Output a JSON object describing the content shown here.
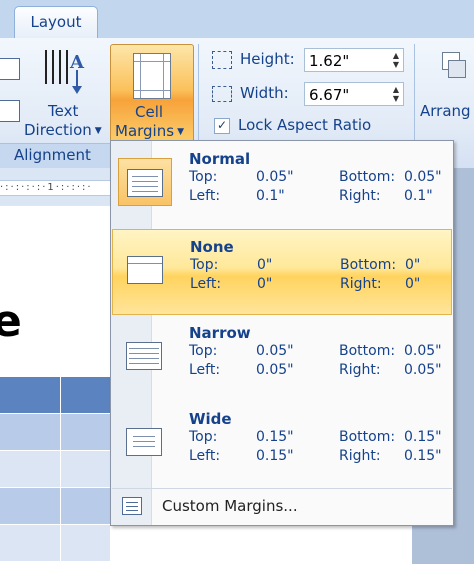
{
  "ribbon": {
    "active_tab": "Layout",
    "alignment_group": "Alignment",
    "text_direction": {
      "line1": "Text",
      "line2": "Direction"
    },
    "cell_margins": {
      "line1": "Cell",
      "line2": "Margins"
    },
    "height_label": "Height:",
    "height_value": "1.62\"",
    "width_label": "Width:",
    "width_value": "6.67\"",
    "lock_aspect_label": "Lock Aspect Ratio",
    "lock_aspect_checked": true,
    "arrange_label": "Arrang"
  },
  "document": {
    "big_char": "e"
  },
  "menu": {
    "items": [
      {
        "name": "Normal",
        "top_label": "Top:",
        "top": "0.05\"",
        "bottom_label": "Bottom:",
        "bottom": "0.05\"",
        "left_label": "Left:",
        "left": "0.1\"",
        "right_label": "Right:",
        "right": "0.1\""
      },
      {
        "name": "None",
        "top_label": "Top:",
        "top": "0\"",
        "bottom_label": "Bottom:",
        "bottom": "0\"",
        "left_label": "Left:",
        "left": "0\"",
        "right_label": "Right:",
        "right": "0\""
      },
      {
        "name": "Narrow",
        "top_label": "Top:",
        "top": "0.05\"",
        "bottom_label": "Bottom:",
        "bottom": "0.05\"",
        "left_label": "Left:",
        "left": "0.05\"",
        "right_label": "Right:",
        "right": "0.05\""
      },
      {
        "name": "Wide",
        "top_label": "Top:",
        "top": "0.15\"",
        "bottom_label": "Bottom:",
        "bottom": "0.15\"",
        "left_label": "Left:",
        "left": "0.15\"",
        "right_label": "Right:",
        "right": "0.15\""
      }
    ],
    "custom_margins": "Custom Margins..."
  },
  "colors": {
    "accent_text": "#15428b",
    "highlight": "#ffd35e",
    "table_header": "#5b83c0",
    "table_row": "#b8cbe8"
  }
}
